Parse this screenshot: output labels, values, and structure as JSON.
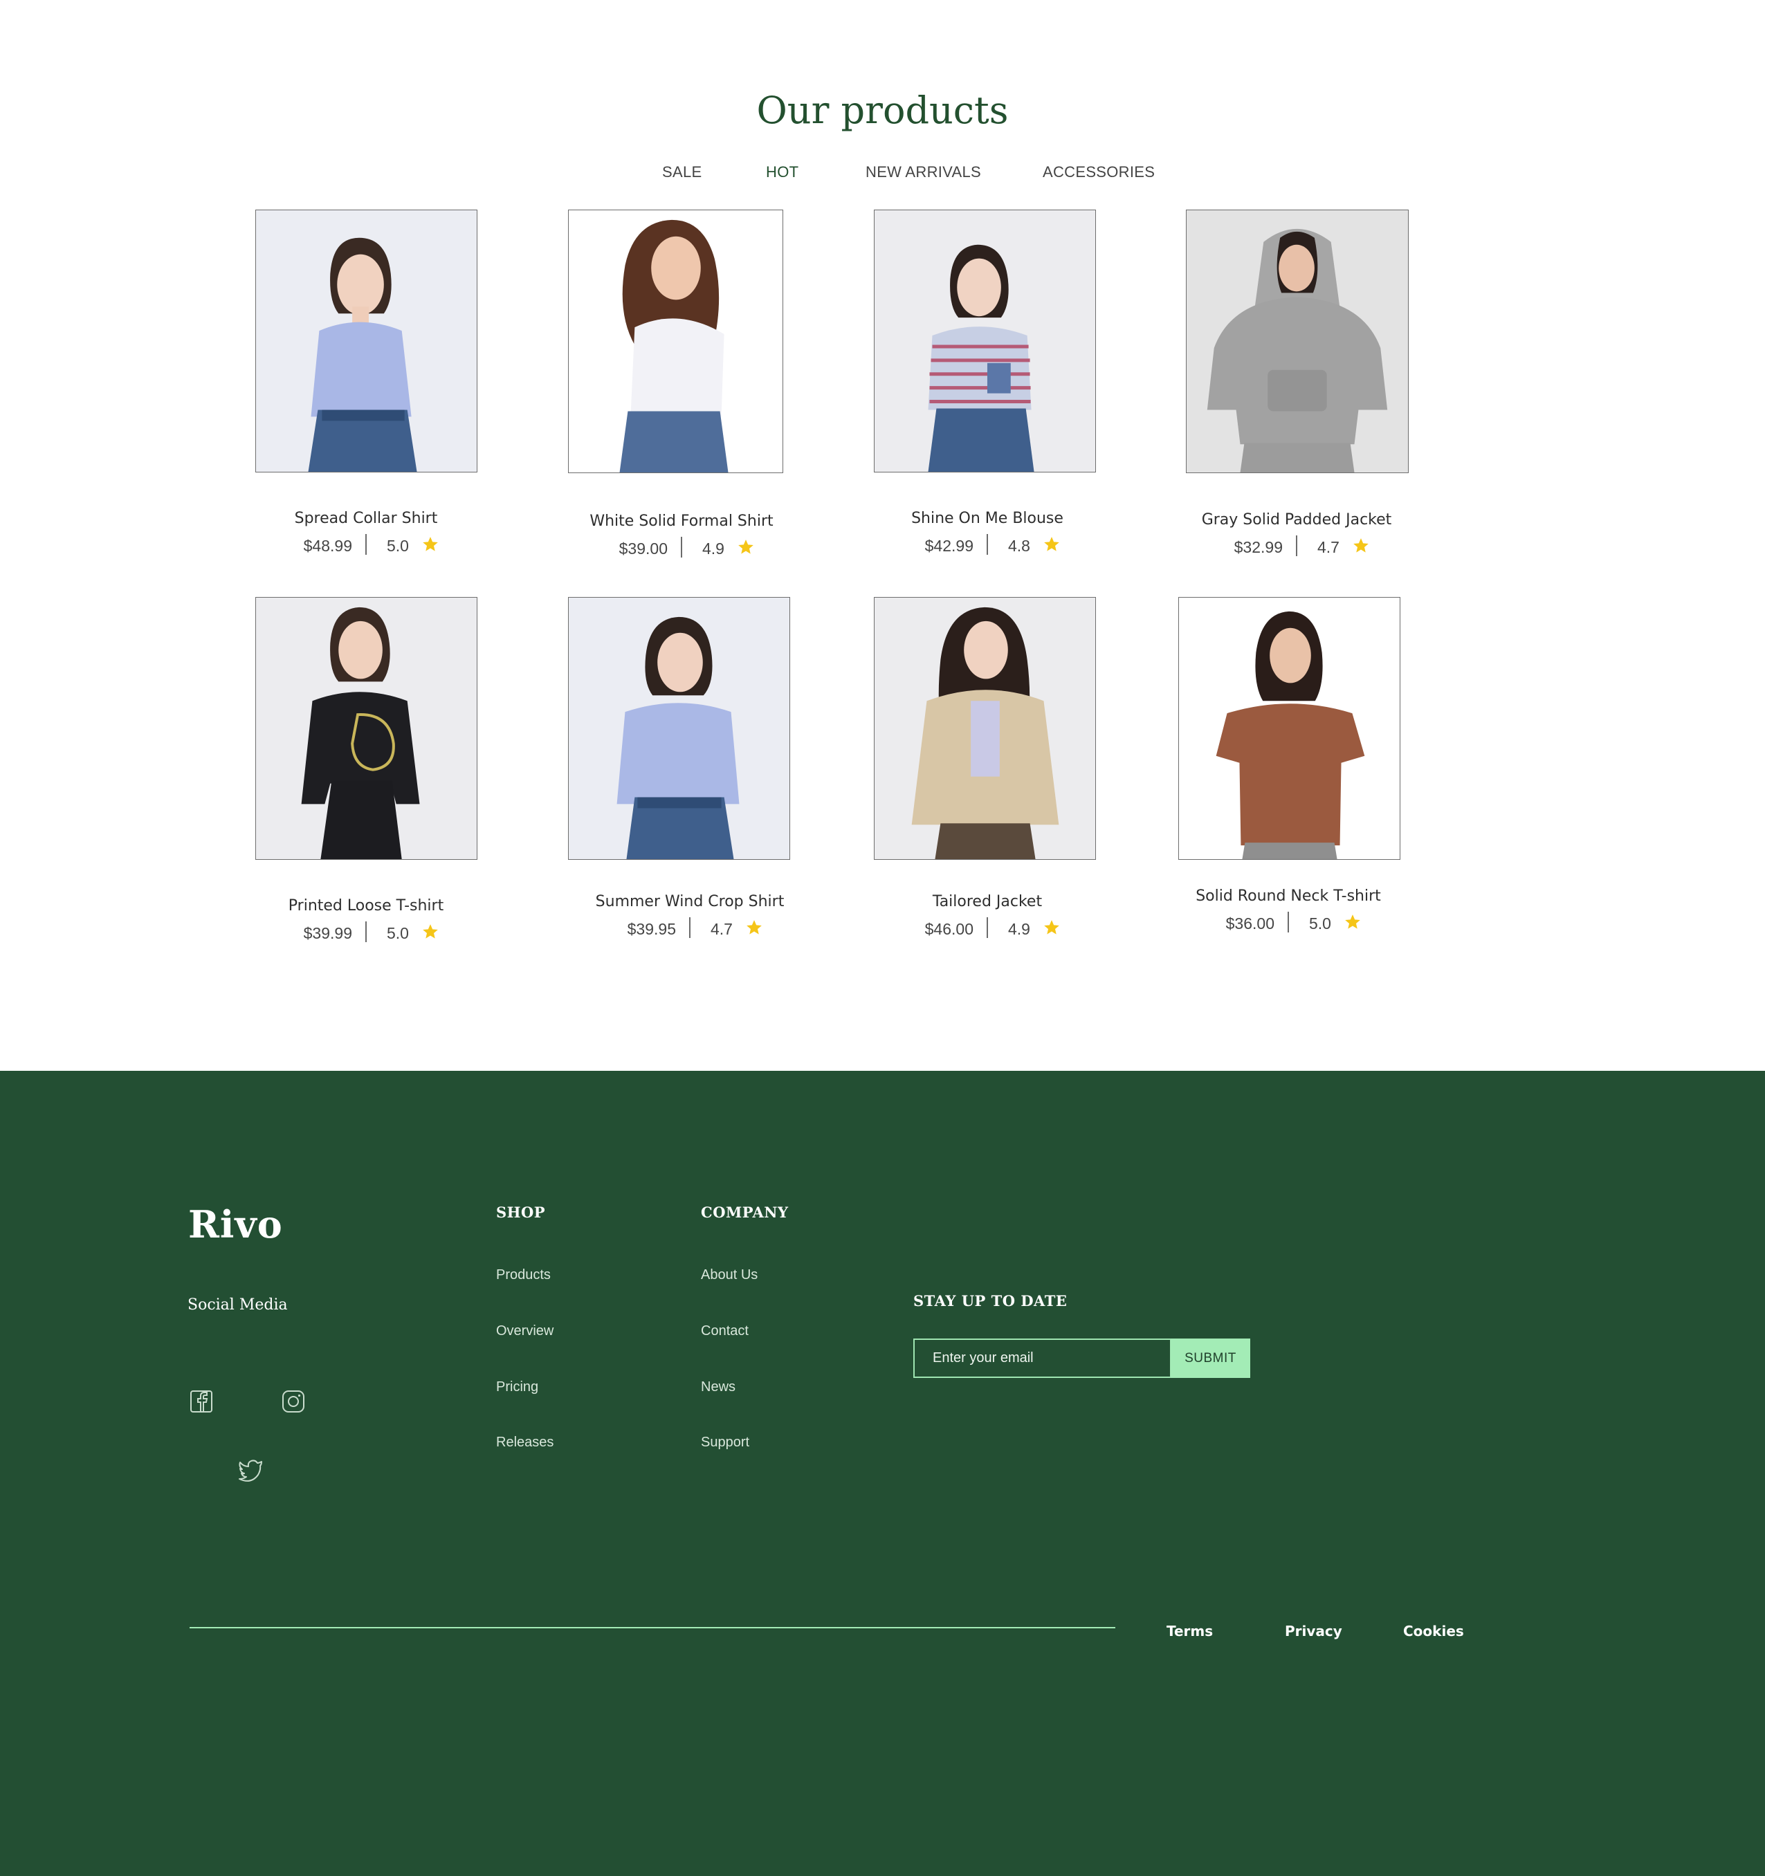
{
  "products_section": {
    "title": "Our products",
    "tabs": [
      {
        "label": "SALE",
        "active": false
      },
      {
        "label": "HOT",
        "active": true
      },
      {
        "label": "NEW ARRIVALS",
        "active": false
      },
      {
        "label": "ACCESSORIES",
        "active": false
      }
    ],
    "products": [
      {
        "name": "Spread Collar Shirt",
        "price": "$48.99",
        "rating": "5.0"
      },
      {
        "name": "White Solid Formal Shirt",
        "price": "$39.00",
        "rating": "4.9"
      },
      {
        "name": "Shine On Me Blouse",
        "price": "$42.99",
        "rating": "4.8"
      },
      {
        "name": "Gray Solid Padded Jacket",
        "price": "$32.99",
        "rating": "4.7"
      },
      {
        "name": "Printed Loose T-shirt",
        "price": "$39.99",
        "rating": "5.0"
      },
      {
        "name": "Summer Wind Crop Shirt",
        "price": "$39.95",
        "rating": "4.7"
      },
      {
        "name": "Tailored Jacket",
        "price": "$46.00",
        "rating": "4.9"
      },
      {
        "name": "Solid Round Neck T-shirt",
        "price": "$36.00",
        "rating": "5.0"
      }
    ],
    "rating_icon": "star-icon"
  },
  "footer": {
    "brand": "Rivo",
    "social_title": "Social Media",
    "social_icons": [
      "facebook-icon",
      "instagram-icon",
      "twitter-icon"
    ],
    "shop": {
      "title": "SHOP",
      "links": [
        "Products",
        "Overview",
        "Pricing",
        "Releases"
      ]
    },
    "company": {
      "title": "COMPANY",
      "links": [
        "About Us",
        "Contact",
        "News",
        "Support"
      ]
    },
    "newsletter": {
      "title": "STAY UP TO DATE",
      "placeholder": "Enter your email",
      "submit_label": "SUBMIT"
    },
    "legal_links": [
      "Terms",
      "Privacy",
      "Cookies"
    ]
  },
  "colors": {
    "brand_green": "#234f33",
    "title_green": "#23502f",
    "accent_mint": "#a3ecb6",
    "star_yellow": "#f5c518"
  }
}
